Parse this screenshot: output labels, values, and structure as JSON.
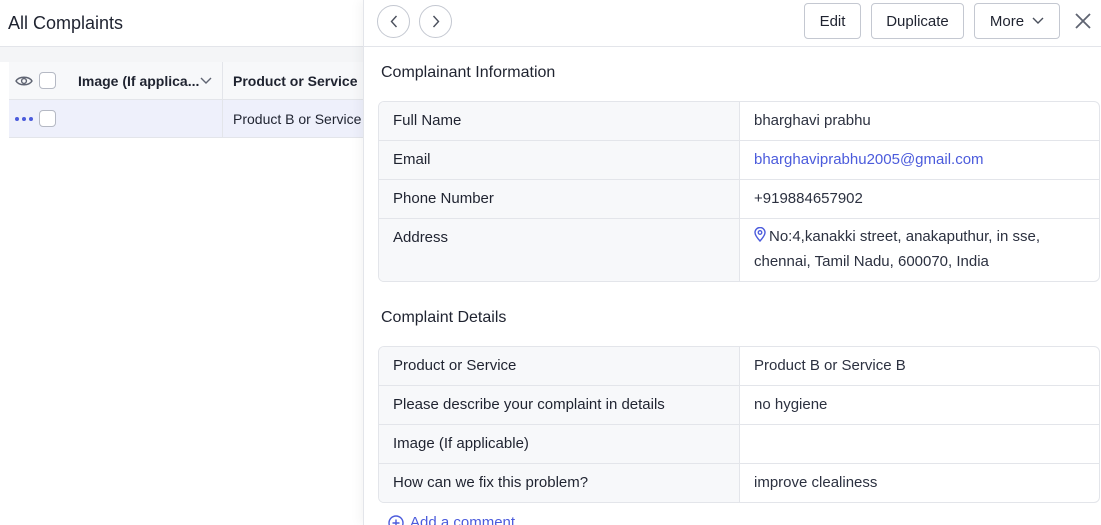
{
  "left": {
    "title": "All Complaints",
    "columns": {
      "image": "Image (If applica...",
      "product": "Product or Service"
    },
    "row": {
      "product": "Product B or Service B"
    }
  },
  "toolbar": {
    "edit": "Edit",
    "duplicate": "Duplicate",
    "more": "More"
  },
  "complainant": {
    "title": "Complainant Information",
    "rows": [
      {
        "key": "Full Name",
        "value": "bharghavi prabhu"
      },
      {
        "key": "Email",
        "value": "bharghaviprabhu2005@gmail.com"
      },
      {
        "key": "Phone Number",
        "value": "+919884657902"
      },
      {
        "key": "Address",
        "value": "No:4,kanakki street, anakaputhur, in sse, chennai, Tamil Nadu, 600070, India"
      }
    ]
  },
  "details": {
    "title": "Complaint Details",
    "rows": [
      {
        "key": "Product or Service",
        "value": "Product B or Service B"
      },
      {
        "key": "Please describe your complaint in details",
        "value": "no hygiene"
      },
      {
        "key": "Image (If applicable)",
        "value": ""
      },
      {
        "key": "How can we fix this problem?",
        "value": "improve clealiness"
      }
    ]
  },
  "comment": {
    "label": "Add a comment"
  },
  "colors": {
    "accent": "#4b5bdc"
  }
}
